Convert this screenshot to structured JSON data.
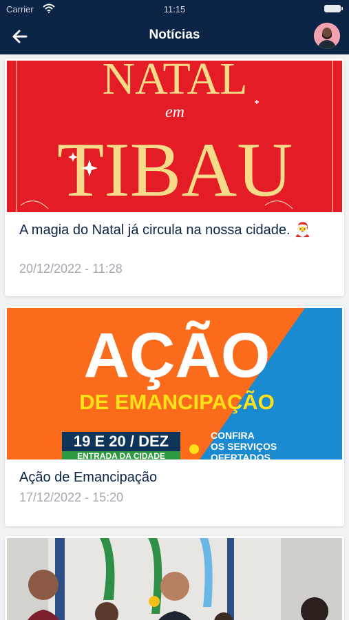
{
  "status": {
    "carrier": "Carrier",
    "time": "11:15"
  },
  "header": {
    "title": "Notícias"
  },
  "news": [
    {
      "title": "A magia do Natal já circula na nossa cidade. 🎅",
      "date": "20/12/2022 - 11:28",
      "image_text": {
        "line1": "NATAL",
        "line2": "em",
        "line3": "TIBAU"
      }
    },
    {
      "title": "Ação de Emancipação",
      "date": "17/12/2022 - 15:20",
      "image_text": {
        "headline": "AÇÃO",
        "subhead": "DE EMANCIPAÇÃO",
        "dates": "19 E 20 / DEZ",
        "place": "ENTRADA DA CIDADE",
        "cta1": "CONFIRA",
        "cta2": "OS SERVIÇOS",
        "cta3": "OFERTADOS"
      }
    },
    {
      "title": "",
      "date": ""
    }
  ],
  "colors": {
    "nav": "#0c2446",
    "title_text": "#0c2446",
    "date_text": "#a3a7ae",
    "natal_red": "#e31c25",
    "acao_orange": "#fb6b1c",
    "acao_blue": "#1a8bd0"
  }
}
